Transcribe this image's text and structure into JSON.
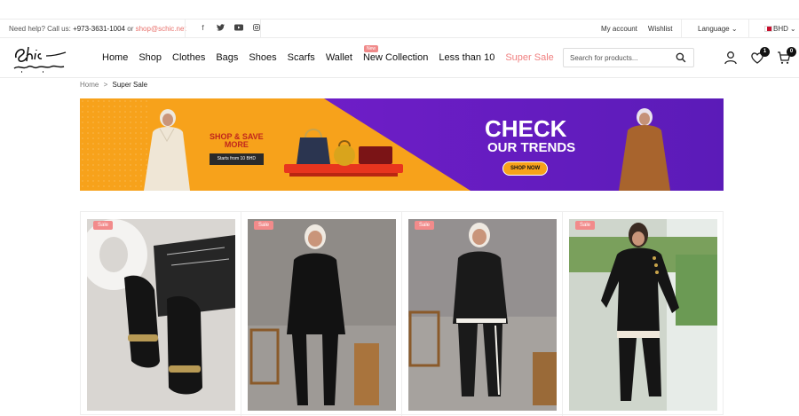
{
  "topbar": {
    "help_label": "Need help? Call us:",
    "phone": "+973-3631-1004",
    "or": "or",
    "email": "shop@schic.net",
    "social_icons": [
      "facebook-icon",
      "twitter-icon",
      "youtube-icon",
      "instagram-icon"
    ],
    "my_account": "My account",
    "wishlist": "Wishlist",
    "language": "Language",
    "currency": "BHD"
  },
  "header": {
    "nav": [
      {
        "label": "Home"
      },
      {
        "label": "Shop"
      },
      {
        "label": "Clothes"
      },
      {
        "label": "Bags"
      },
      {
        "label": "Shoes"
      },
      {
        "label": "Scarfs"
      },
      {
        "label": "Wallet"
      },
      {
        "label": "New Collection",
        "tag": "New"
      },
      {
        "label": "Less than 10"
      },
      {
        "label": "Super Sale",
        "highlight": "#f08080"
      }
    ],
    "search_placeholder": "Search for products...",
    "wishlist_count": "1",
    "cart_count": "0"
  },
  "breadcrumb": {
    "home": "Home",
    "sep": ">",
    "current": "Super Sale"
  },
  "banner": {
    "left_line1": "SHOP & SAVE",
    "left_line2": "MORE",
    "left_sub": "Starts from 10 BHD",
    "check": "CHECK",
    "trends": "OUR TRENDS",
    "cta": "SHOP NOW"
  },
  "products": [
    {
      "badge": "Sale"
    },
    {
      "badge": "Sale"
    },
    {
      "badge": "Sale"
    },
    {
      "badge": "Sale"
    }
  ],
  "colors": {
    "accent": "#f08080",
    "banner_orange": "#f7a21b",
    "banner_purple": "#6a1fc4"
  }
}
